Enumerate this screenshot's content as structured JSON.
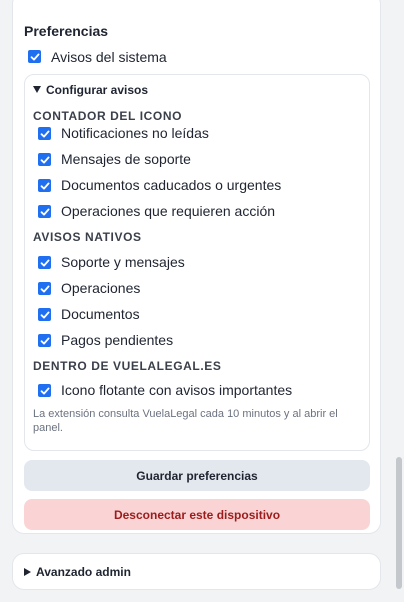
{
  "preferences": {
    "title": "Preferencias",
    "system_alerts_label": "Avisos del sistema",
    "system_alerts_checked": true,
    "configure": {
      "summary": "Configurar avisos",
      "icon_counter": {
        "heading": "CONTADOR DEL ICONO",
        "items": [
          {
            "label": "Notificaciones no leídas",
            "checked": true
          },
          {
            "label": "Mensajes de soporte",
            "checked": true
          },
          {
            "label": "Documentos caducados o urgentes",
            "checked": true
          },
          {
            "label": "Operaciones que requieren acción",
            "checked": true
          }
        ]
      },
      "native_alerts": {
        "heading": "AVISOS NATIVOS",
        "items": [
          {
            "label": "Soporte y mensajes",
            "checked": true
          },
          {
            "label": "Operaciones",
            "checked": true
          },
          {
            "label": "Documentos",
            "checked": true
          },
          {
            "label": "Pagos pendientes",
            "checked": true
          }
        ]
      },
      "inside_site": {
        "heading": "DENTRO DE VUELALEGAL.ES",
        "items": [
          {
            "label": "Icono flotante con avisos importantes",
            "checked": true
          }
        ]
      },
      "note": "La extensión consulta VuelaLegal cada 10 minutos y al abrir el panel."
    },
    "save_label": "Guardar preferencias",
    "disconnect_label": "Desconectar este dispositivo"
  },
  "admin": {
    "summary": "Avanzado admin"
  },
  "colors": {
    "accent": "#1f6ff0",
    "danger_bg": "#fad4d4",
    "danger_text": "#9b1c1c"
  }
}
